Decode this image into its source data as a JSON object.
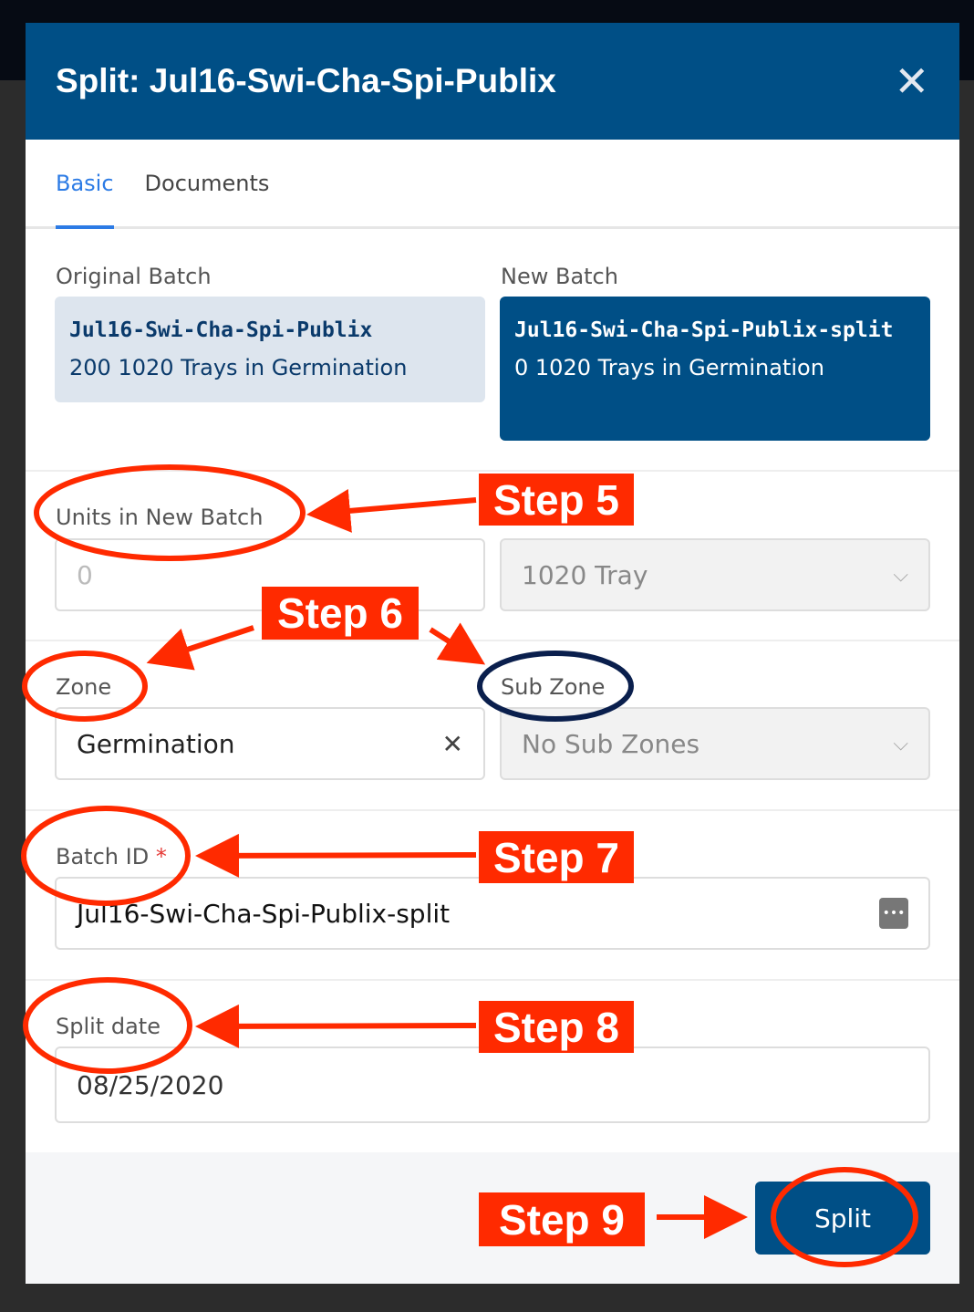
{
  "modal": {
    "title": "Split: Jul16-Swi-Cha-Spi-Publix",
    "close_icon": "close-icon"
  },
  "tabs": [
    {
      "label": "Basic",
      "active": true
    },
    {
      "label": "Documents",
      "active": false
    }
  ],
  "original": {
    "label": "Original Batch",
    "name": "Jul16-Swi-Cha-Spi-Publix",
    "detail": "200 1020 Trays in Germination"
  },
  "new_batch": {
    "label": "New Batch",
    "name": "Jul16-Swi-Cha-Spi-Publix-split",
    "detail": "0 1020 Trays in Germination"
  },
  "units": {
    "label": "Units in New Batch",
    "placeholder": "0",
    "unit": "1020 Tray"
  },
  "zone": {
    "label": "Zone",
    "value": "Germination"
  },
  "sub_zone": {
    "label": "Sub Zone",
    "value": "No Sub Zones"
  },
  "batch_id": {
    "label": "Batch ID",
    "required": "*",
    "value": "Jul16-Swi-Cha-Spi-Publix-split"
  },
  "split_date": {
    "label": "Split date",
    "value": "08/25/2020"
  },
  "footer": {
    "split_label": "Split"
  },
  "annotations": {
    "step5": "Step 5",
    "step6": "Step 6",
    "step7": "Step 7",
    "step8": "Step 8",
    "step9": "Step 9",
    "color": "#ff2a00",
    "subzone_circle_color": "#0a1f4d"
  },
  "colors": {
    "primary": "#004f86",
    "tab_active": "#2c7be5"
  }
}
